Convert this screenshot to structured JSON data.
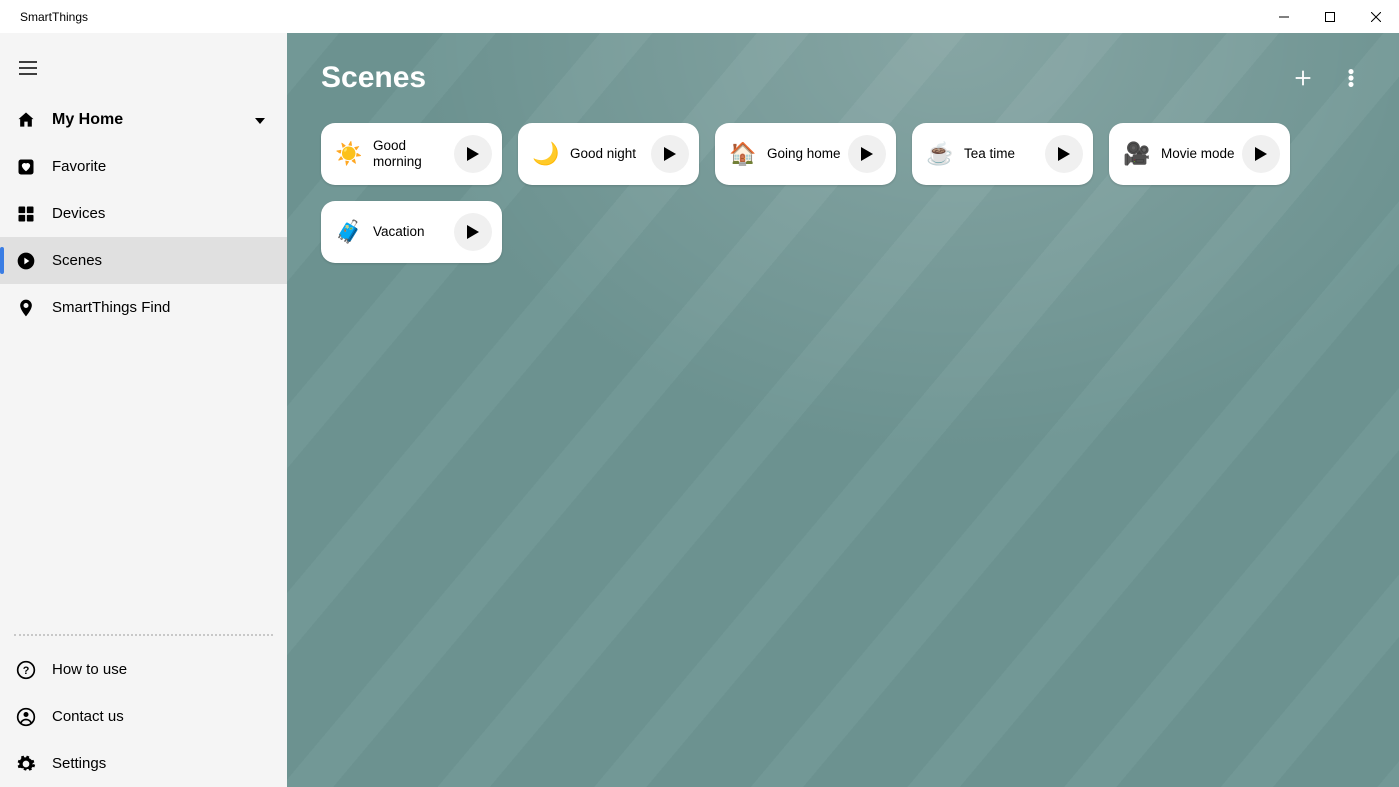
{
  "window": {
    "app_title": "SmartThings"
  },
  "sidebar": {
    "home_label": "My Home",
    "items": {
      "favorite": "Favorite",
      "devices": "Devices",
      "scenes": "Scenes",
      "find": "SmartThings Find"
    },
    "footer": {
      "how_to_use": "How to use",
      "contact_us": "Contact us",
      "settings": "Settings"
    }
  },
  "page": {
    "title": "Scenes"
  },
  "scenes": [
    {
      "emoji": "☀️",
      "label": "Good morning"
    },
    {
      "emoji": "🌙",
      "label": "Good night"
    },
    {
      "emoji": "🏠",
      "label": "Going home"
    },
    {
      "emoji": "☕",
      "label": "Tea time"
    },
    {
      "emoji": "🎥",
      "label": "Movie mode"
    },
    {
      "emoji": "🧳",
      "label": "Vacation"
    }
  ]
}
